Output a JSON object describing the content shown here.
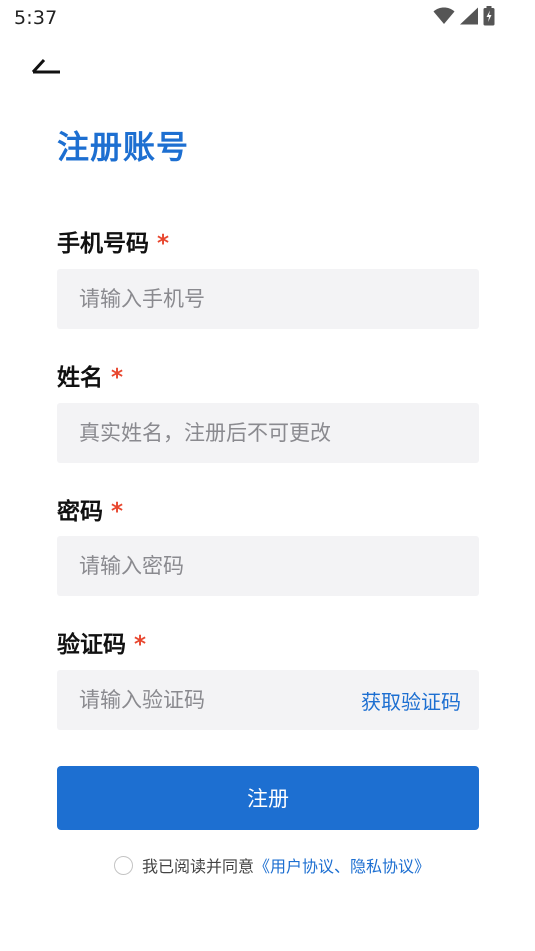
{
  "status_bar": {
    "time": "5:37",
    "icons": [
      "wifi-icon",
      "cellular-signal-icon",
      "battery-charging-icon"
    ]
  },
  "header": {
    "back_icon": "back-arrow-icon",
    "title": "注册账号"
  },
  "form": {
    "phone": {
      "label": "手机号码",
      "required_mark": "*",
      "placeholder": "请输入手机号",
      "value": ""
    },
    "name": {
      "label": "姓名",
      "required_mark": "*",
      "placeholder": "真实姓名，注册后不可更改",
      "value": ""
    },
    "password": {
      "label": "密码",
      "required_mark": "*",
      "placeholder": "请输入密码",
      "value": ""
    },
    "code": {
      "label": "验证码",
      "required_mark": "*",
      "placeholder": "请输入验证码",
      "value": "",
      "get_code_label": "获取验证码"
    }
  },
  "submit_label": "注册",
  "agreement": {
    "checked": false,
    "prefix": "我已阅读并同意",
    "links": "《用户协议、隐私协议》"
  },
  "colors": {
    "accent": "#1d6fd1",
    "required": "#e8472f",
    "input_bg": "#f3f3f5",
    "placeholder": "#8a8a8f"
  }
}
